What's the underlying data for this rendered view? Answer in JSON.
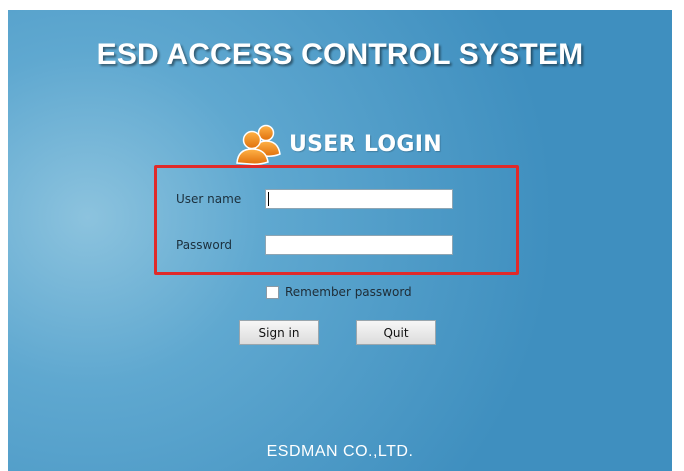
{
  "app": {
    "title": "ESD ACCESS CONTROL SYSTEM",
    "login_heading": "USER LOGIN",
    "icon": "users-icon"
  },
  "form": {
    "username_label": "User name",
    "username_value": "",
    "password_label": "Password",
    "password_value": "",
    "remember_label": "Remember password",
    "remember_checked": false,
    "sign_in_label": "Sign in",
    "quit_label": "Quit"
  },
  "footer": {
    "company": "ESDMAN CO.,LTD."
  },
  "colors": {
    "background": "#4f9fcb",
    "highlight_border": "#e02a2a",
    "icon_orange": "#f08a1c",
    "title_text": "#ffffff"
  }
}
